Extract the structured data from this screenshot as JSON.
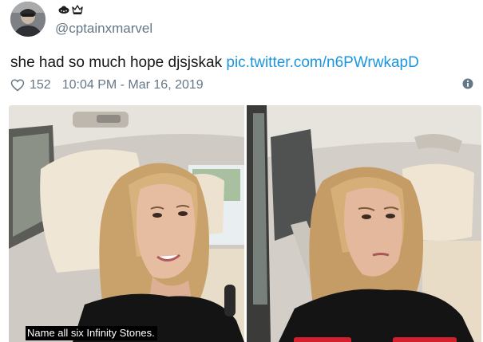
{
  "author": {
    "handle": "@cptainxmarvel",
    "badge_icons": [
      "alien-ship-icon",
      "crown-icon"
    ]
  },
  "tweet": {
    "text": "she had so much hope djsjskak ",
    "link": "pic.twitter.com/n6PWrwkapD",
    "likes": "152",
    "timestamp": "10:04 PM - Mar 16, 2019"
  },
  "media": {
    "caption": "Name all six Infinity Stones."
  },
  "colors": {
    "link": "#1b95e0",
    "meta": "#657786",
    "text": "#14171a"
  }
}
